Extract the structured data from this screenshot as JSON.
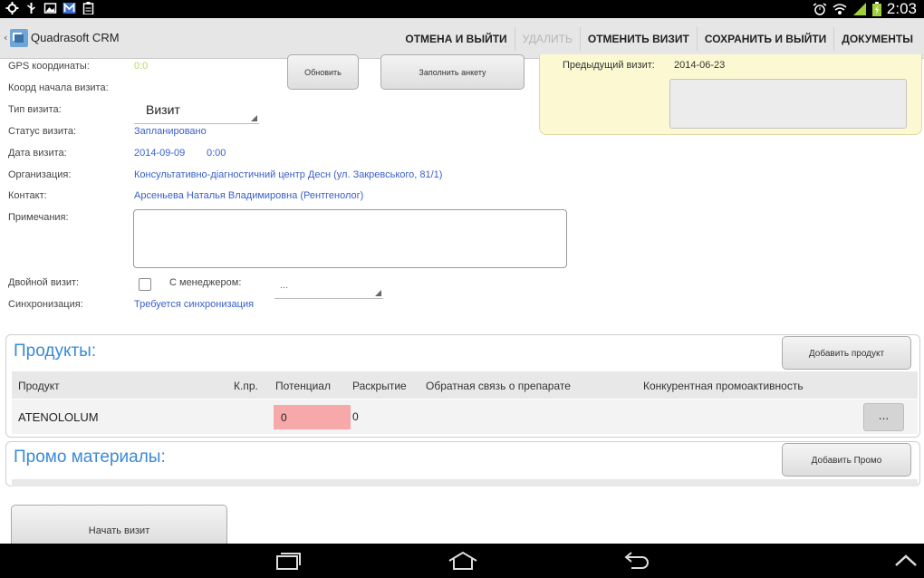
{
  "status_bar": {
    "time": "2:03",
    "icons": [
      "location-icon",
      "usb-icon",
      "image-icon",
      "mail-icon",
      "clipboard-icon",
      "alarm-icon",
      "wifi-icon",
      "signal-icon",
      "battery-icon"
    ]
  },
  "action_bar": {
    "title": "Quadrasoft CRM",
    "actions": [
      {
        "label": "ОТМЕНА И ВЫЙТИ",
        "enabled": true
      },
      {
        "label": "УДАЛИТЬ",
        "enabled": false
      },
      {
        "label": "ОТМЕНИТЬ ВИЗИТ",
        "enabled": true
      },
      {
        "label": "СОХРАНИТЬ И ВЫЙТИ",
        "enabled": true
      },
      {
        "label": "ДОКУМЕНТЫ",
        "enabled": true
      }
    ]
  },
  "form": {
    "gps_label": "GPS координаты:",
    "gps_value": "0:0",
    "start_coord_label": "Коорд начала визита:",
    "refresh_button": "Обновить",
    "fill_survey_button": "Заполнить анкету",
    "visit_type_label": "Тип визита:",
    "visit_type_value": "Визит",
    "status_label": "Статус визита:",
    "status_value": "Запланировано",
    "date_label": "Дата визита:",
    "date_value": "2014-09-09",
    "time_value": "0:00",
    "organization_label": "Организация:",
    "organization_value": "Консультативно-діагностичний центр Десн (ул. Закревського, 81/1)",
    "contact_label": "Контакт:",
    "contact_value": "Арсеньева Наталья Владимировна (Рентгенолог)",
    "notes_label": "Примечания:",
    "notes_value": "",
    "double_visit_label": "Двойной визит:",
    "double_visit_checked": false,
    "manager_label": "С менеджером:",
    "manager_value": "...",
    "sync_label": "Синхронизация:",
    "sync_value": "Требуется синхронизация"
  },
  "previous_visit": {
    "label": "Предыдущий визит:",
    "date": "2014-06-23"
  },
  "products": {
    "title": "Продукты:",
    "add_button": "Добавить продукт",
    "columns": [
      "Продукт",
      "К.пр.",
      "Потенциал",
      "Раскрытие",
      "Обратная связь о препарате",
      "Конкурентная промоактивность"
    ],
    "rows": [
      {
        "product": "ATENOLOLUM",
        "count": "",
        "potential": "0",
        "disclosure": "0",
        "feedback": "",
        "competitive": "",
        "action": "..."
      }
    ]
  },
  "promo": {
    "title": "Промо материалы:",
    "add_button": "Добавить Промо"
  },
  "start_visit_button": "Начать визит",
  "colors": {
    "link": "#3a5fc8",
    "section_title": "#3a8ad6",
    "highlight_cell": "#f7a9a9",
    "panel_yellow": "#fcf9d2"
  }
}
